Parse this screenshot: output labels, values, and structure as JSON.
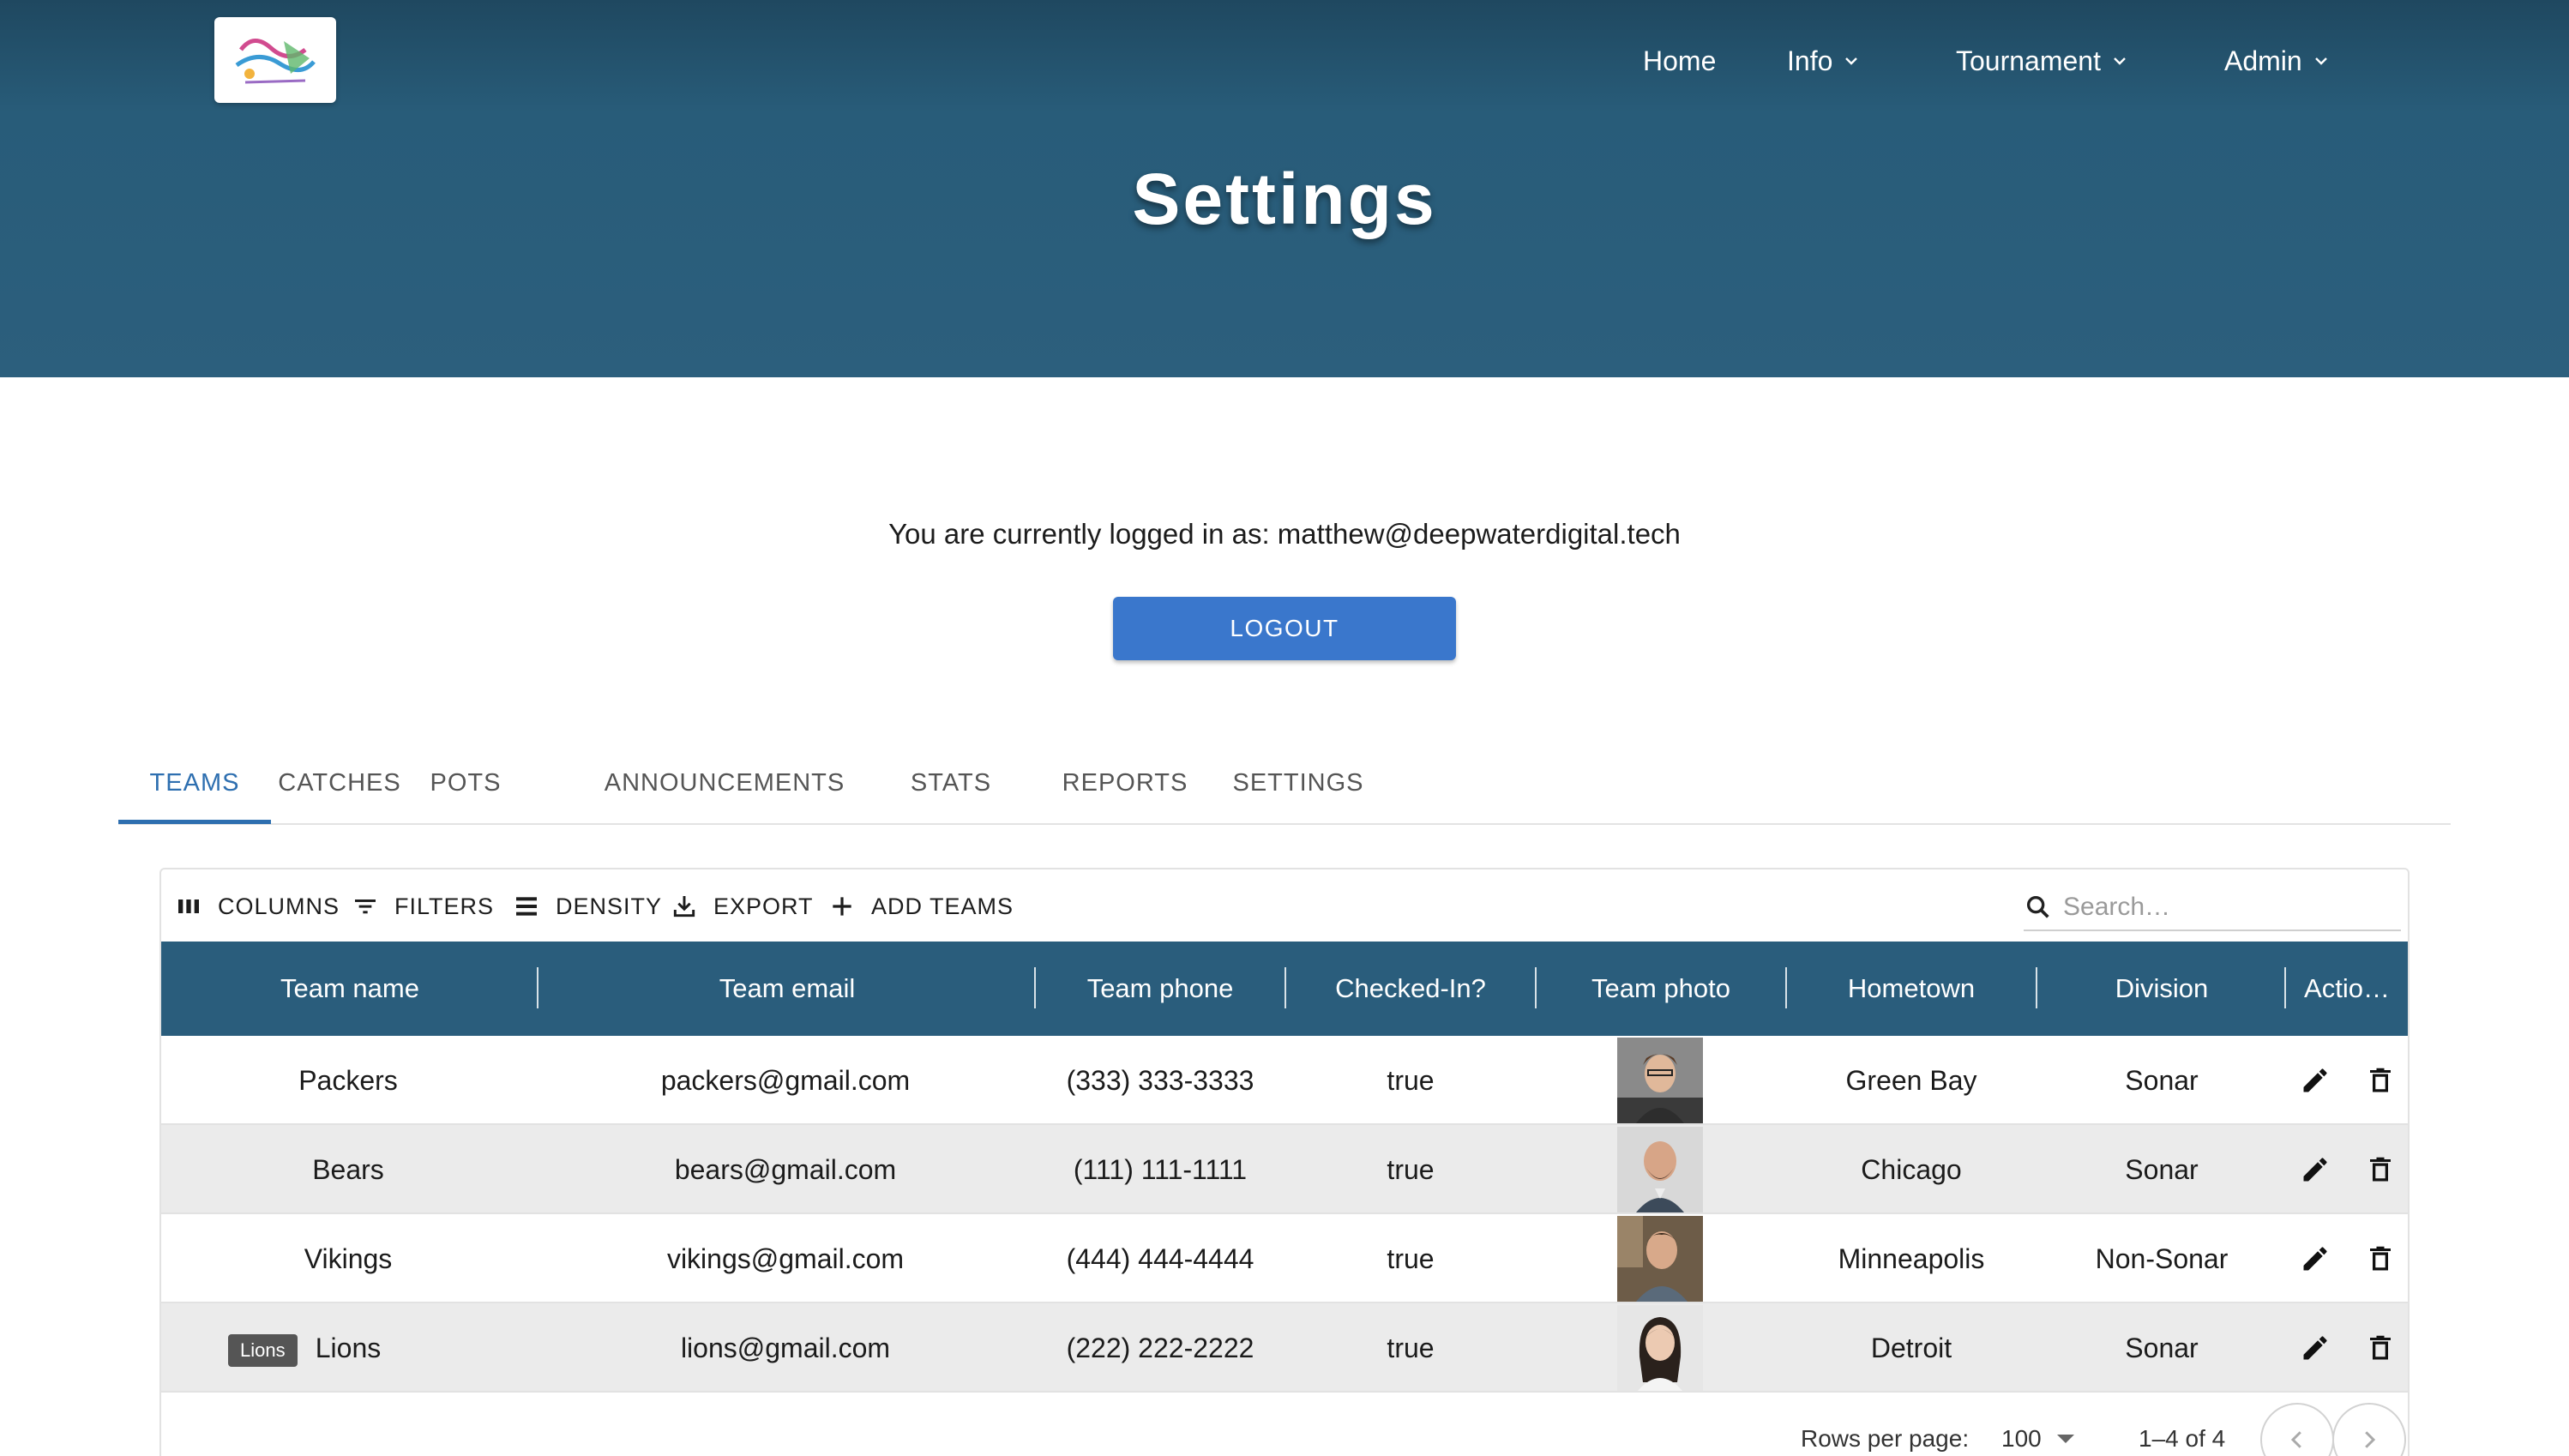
{
  "nav": {
    "home": "Home",
    "info": "Info",
    "tournament": "Tournament",
    "admin": "Admin"
  },
  "page_title": "Settings",
  "login": {
    "message": "You are currently logged in as: matthew@deepwaterdigital.tech",
    "logout_label": "LOGOUT"
  },
  "tabs": [
    "TEAMS",
    "CATCHES",
    "POTS",
    "ANNOUNCEMENTS",
    "STATS",
    "REPORTS",
    "SETTINGS"
  ],
  "active_tab": "TEAMS",
  "toolbar": {
    "columns": "COLUMNS",
    "filters": "FILTERS",
    "density": "DENSITY",
    "export": "EXPORT",
    "add_teams": "ADD TEAMS",
    "search_placeholder": "Search…"
  },
  "columns": [
    "Team name",
    "Team email",
    "Team phone",
    "Checked-In?",
    "Team photo",
    "Hometown",
    "Division",
    "Actio…"
  ],
  "rows": [
    {
      "name": "Packers",
      "email": "packers@gmail.com",
      "phone": "(333) 333-3333",
      "checked_in": "true",
      "hometown": "Green Bay",
      "division": "Sonar"
    },
    {
      "name": "Bears",
      "email": "bears@gmail.com",
      "phone": "(111) 111-1111",
      "checked_in": "true",
      "hometown": "Chicago",
      "division": "Sonar"
    },
    {
      "name": "Vikings",
      "email": "vikings@gmail.com",
      "phone": "(444) 444-4444",
      "checked_in": "true",
      "hometown": "Minneapolis",
      "division": "Non-Sonar"
    },
    {
      "name": "Lions",
      "email": "lions@gmail.com",
      "phone": "(222) 222-2222",
      "checked_in": "true",
      "hometown": "Detroit",
      "division": "Sonar"
    }
  ],
  "tooltip": "Lions",
  "footer": {
    "rows_per_page_label": "Rows per page:",
    "rows_per_page_value": "100",
    "range": "1–4 of 4"
  },
  "colors": {
    "header_bg": "#2c5f7d",
    "table_header_bg": "#2a5d7c",
    "button_blue": "#3a77cc",
    "tab_active": "#2e6fb0"
  }
}
